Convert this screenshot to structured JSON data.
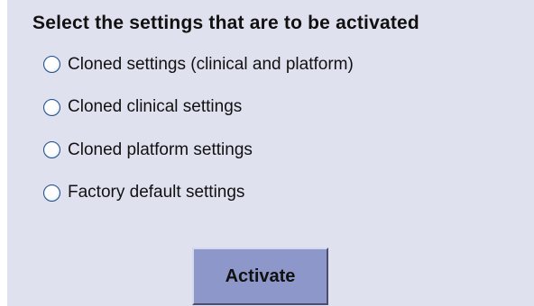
{
  "dialog": {
    "heading": "Select the settings that are to be activated",
    "options": [
      {
        "label": "Cloned settings (clinical and platform)",
        "selected": false
      },
      {
        "label": "Cloned clinical settings",
        "selected": false
      },
      {
        "label": "Cloned platform settings",
        "selected": false
      },
      {
        "label": "Factory default settings",
        "selected": false
      }
    ],
    "activate_label": "Activate"
  },
  "colors": {
    "panel_background": "#e0e1ef",
    "button_background": "#8e97c9",
    "radio_border": "#1f4d8c"
  }
}
